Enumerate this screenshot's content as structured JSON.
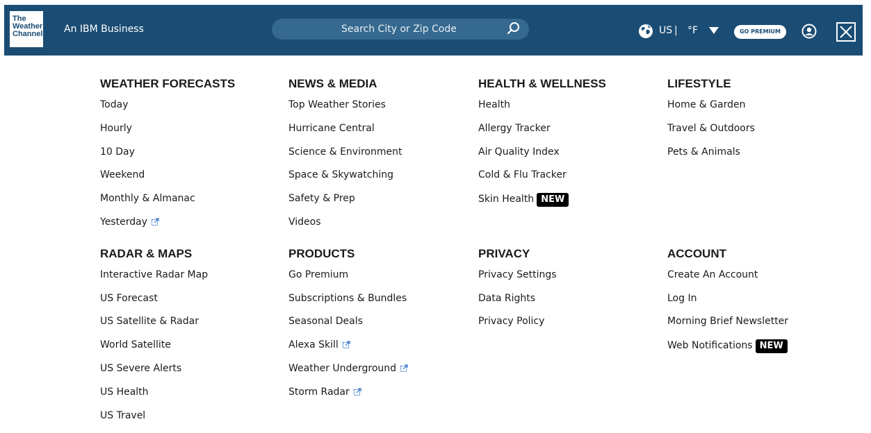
{
  "header": {
    "logo_lines": [
      "The",
      "Weather",
      "Channel"
    ],
    "tagline": "An IBM Business",
    "search_placeholder": "Search City or Zip Code",
    "locale": "US",
    "divider": "|",
    "unit": "°F",
    "premium_label": "GO PREMIUM"
  },
  "colors": {
    "header_bg": "#1b4d74",
    "search_bg": "#35698f",
    "link_icon": "#3a78c9",
    "badge_bg": "#000000"
  },
  "menu": {
    "weather_forecasts": {
      "title": "WEATHER FORECASTS",
      "items": [
        "Today",
        "Hourly",
        "10 Day",
        "Weekend",
        "Monthly & Almanac",
        "Yesterday"
      ]
    },
    "news_media": {
      "title": "NEWS & MEDIA",
      "items": [
        "Top Weather Stories",
        "Hurricane Central",
        "Science & Environment",
        "Space & Skywatching",
        "Safety & Prep",
        "Videos"
      ]
    },
    "health_wellness": {
      "title": "HEALTH & WELLNESS",
      "items": [
        "Health",
        "Allergy Tracker",
        "Air Quality Index",
        "Cold & Flu Tracker",
        "Skin Health"
      ],
      "badge": "NEW"
    },
    "lifestyle": {
      "title": "LIFESTYLE",
      "items": [
        "Home & Garden",
        "Travel & Outdoors",
        "Pets & Animals"
      ]
    },
    "radar_maps": {
      "title": "RADAR & MAPS",
      "items": [
        "Interactive Radar Map",
        "US Forecast",
        "US Satellite & Radar",
        "World Satellite",
        "US Severe Alerts",
        "US Health",
        "US Travel"
      ]
    },
    "products": {
      "title": "PRODUCTS",
      "items": [
        "Go Premium",
        "Subscriptions & Bundles",
        "Seasonal Deals",
        "Alexa Skill",
        "Weather Underground",
        "Storm Radar"
      ]
    },
    "privacy": {
      "title": "PRIVACY",
      "items": [
        "Privacy Settings",
        "Data Rights",
        "Privacy Policy"
      ]
    },
    "account": {
      "title": "ACCOUNT",
      "items": [
        "Create An Account",
        "Log In",
        "Morning Brief Newsletter",
        "Web Notifications"
      ],
      "badge": "NEW"
    }
  }
}
